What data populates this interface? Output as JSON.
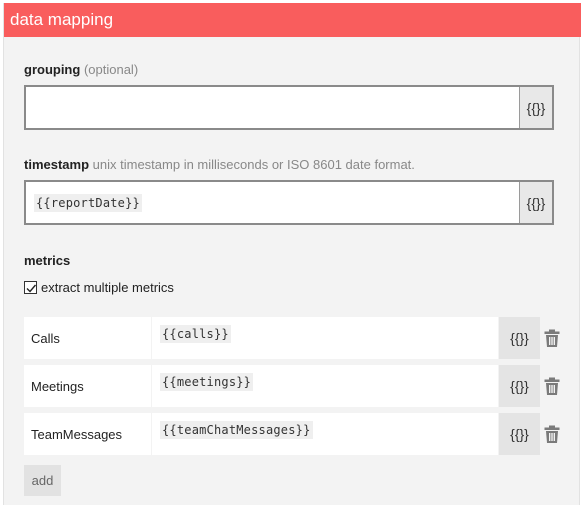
{
  "header": {
    "title": "data mapping"
  },
  "grouping": {
    "label": "grouping",
    "hint": "(optional)",
    "value": "",
    "var_button": "{{}}"
  },
  "timestamp": {
    "label": "timestamp",
    "hint": "unix timestamp in milliseconds or ISO 8601 date format.",
    "value": "{{reportDate}}",
    "var_button": "{{}}"
  },
  "metrics": {
    "label": "metrics",
    "extract_multiple": {
      "label": "extract multiple metrics",
      "checked": true
    },
    "rows": [
      {
        "name": "Calls",
        "value": "{{calls}}",
        "var_button": "{{}}",
        "delete_icon": "trash-icon"
      },
      {
        "name": "Meetings",
        "value": "{{meetings}}",
        "var_button": "{{}}",
        "delete_icon": "trash-icon"
      },
      {
        "name": "TeamMessages",
        "value": "{{teamChatMessages}}",
        "var_button": "{{}}",
        "delete_icon": "trash-icon"
      }
    ],
    "add_label": "add"
  },
  "colors": {
    "header_bg": "#f95d5d",
    "panel_bg": "#f3f3f3"
  }
}
